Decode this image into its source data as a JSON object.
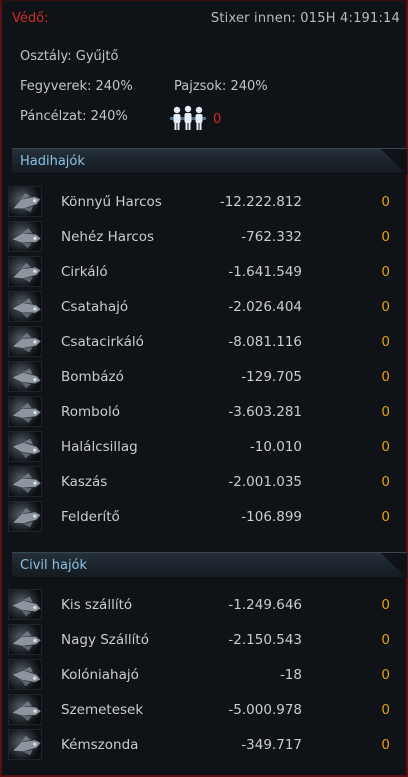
{
  "header": {
    "role": "Védő:",
    "player": "Stixer innen: 015H 4:191:14"
  },
  "stats": {
    "class_label": "Osztály:",
    "class_value": "Gyűjtő",
    "weapons_label": "Fegyverek:",
    "weapons_value": "240%",
    "shields_label": "Pajzsok:",
    "shields_value": "240%",
    "armor_label": "Páncélzat:",
    "armor_value": "240%",
    "crew_icon": "crew-icon",
    "crew_value": "0"
  },
  "colors": {
    "accent_red": "#d12b2b",
    "count_orange": "#e3a10f",
    "section_blue": "#8cc1e6"
  },
  "military": {
    "title": "Hadihajók",
    "ships": [
      {
        "name": "Könnyű Harcos",
        "loss": "-12.222.812",
        "count": "0"
      },
      {
        "name": "Nehéz Harcos",
        "loss": "-762.332",
        "count": "0"
      },
      {
        "name": "Cirkáló",
        "loss": "-1.641.549",
        "count": "0"
      },
      {
        "name": "Csatahajó",
        "loss": "-2.026.404",
        "count": "0"
      },
      {
        "name": "Csatacirkáló",
        "loss": "-8.081.116",
        "count": "0"
      },
      {
        "name": "Bombázó",
        "loss": "-129.705",
        "count": "0"
      },
      {
        "name": "Romboló",
        "loss": "-3.603.281",
        "count": "0"
      },
      {
        "name": "Halálcsillag",
        "loss": "-10.010",
        "count": "0"
      },
      {
        "name": "Kaszás",
        "loss": "-2.001.035",
        "count": "0"
      },
      {
        "name": "Felderítő",
        "loss": "-106.899",
        "count": "0"
      }
    ]
  },
  "civil": {
    "title": "Civil hajók",
    "ships": [
      {
        "name": "Kis szállító",
        "loss": "-1.249.646",
        "count": "0"
      },
      {
        "name": "Nagy Szállító",
        "loss": "-2.150.543",
        "count": "0"
      },
      {
        "name": "Kolóniahajó",
        "loss": "-18",
        "count": "0"
      },
      {
        "name": "Szemetesek",
        "loss": "-5.000.978",
        "count": "0"
      },
      {
        "name": "Kémszonda",
        "loss": "-349.717",
        "count": "0"
      }
    ]
  }
}
